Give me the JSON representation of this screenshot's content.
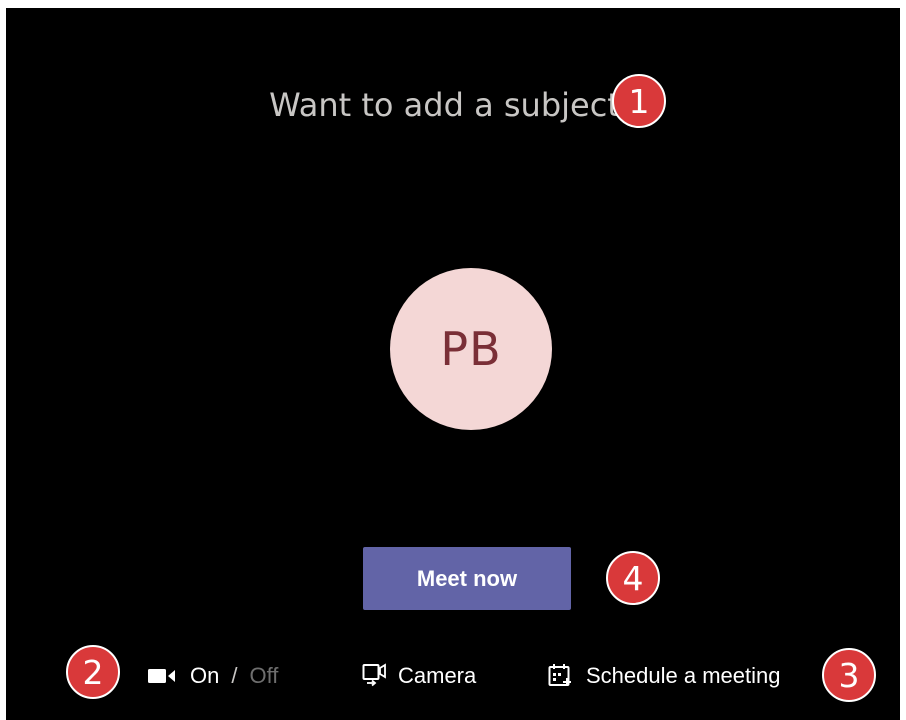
{
  "header": {
    "subject_prompt": "Want to add a subject?"
  },
  "avatar": {
    "initials": "PB",
    "background_color": "#f4d7d6",
    "text_color": "#7a2f37"
  },
  "main": {
    "meet_now_label": "Meet now",
    "accent_color": "#6264a7"
  },
  "controls": {
    "video": {
      "icon": "video-camera-icon",
      "on_label": "On",
      "separator": "/",
      "off_label": "Off",
      "state": "On"
    },
    "camera": {
      "icon": "camera-switch-icon",
      "label": "Camera"
    },
    "schedule": {
      "icon": "calendar-add-icon",
      "label": "Schedule a meeting"
    }
  },
  "callouts": {
    "subject": "1",
    "video": "2",
    "schedule": "3",
    "meet_now": "4",
    "color": "#d9393a"
  }
}
